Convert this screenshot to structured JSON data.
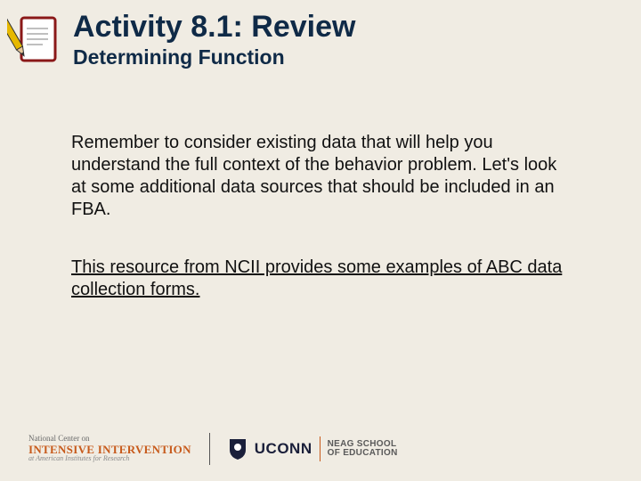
{
  "header": {
    "title": "Activity 8.1: Review",
    "subtitle": "Determining Function",
    "icon": "pencil-paper-icon"
  },
  "body": {
    "paragraph1": "Remember to consider existing data that will help you understand the full context of the behavior problem. Let's look at some additional data sources that should be included in an FBA.",
    "paragraph2": "This resource from NCII provides some examples of ABC data collection forms."
  },
  "footer": {
    "ncii": {
      "line1": "National Center on",
      "line2": "INTENSIVE INTERVENTION",
      "line3": "at American Institutes for Research"
    },
    "uconn": {
      "name": "UCONN",
      "school1": "NEAG SCHOOL",
      "school2": "OF EDUCATION"
    }
  }
}
